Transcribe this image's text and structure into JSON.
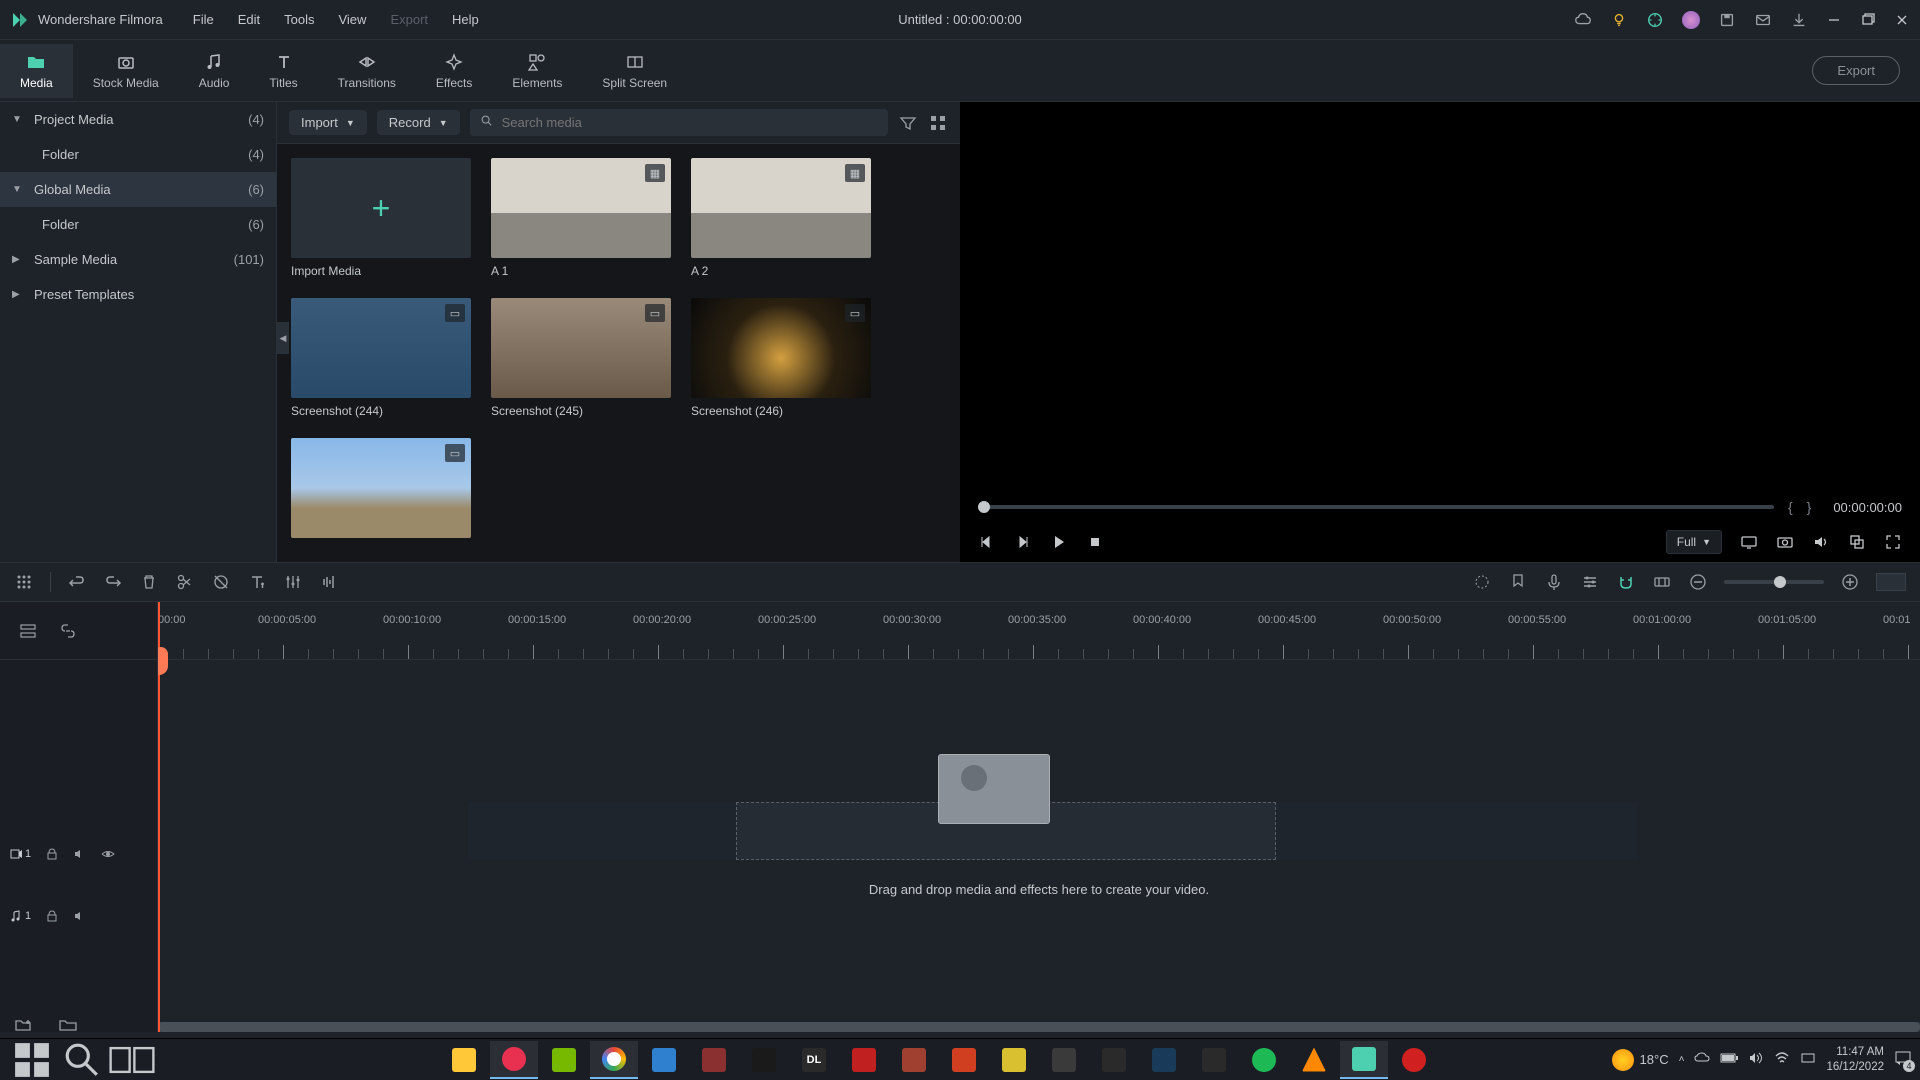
{
  "app": {
    "name": "Wondershare Filmora"
  },
  "titlebar": {
    "menus": [
      "File",
      "Edit",
      "Tools",
      "View",
      "Export",
      "Help"
    ],
    "disabled_menu_idx": 4,
    "title": "Untitled : 00:00:00:00"
  },
  "tabs": {
    "items": [
      "Media",
      "Stock Media",
      "Audio",
      "Titles",
      "Transitions",
      "Effects",
      "Elements",
      "Split Screen"
    ],
    "active": 0,
    "export": "Export"
  },
  "tree": {
    "items": [
      {
        "label": "Project Media",
        "count": "(4)",
        "arrow": "▼",
        "child": false
      },
      {
        "label": "Folder",
        "count": "(4)",
        "arrow": "",
        "child": true
      },
      {
        "label": "Global Media",
        "count": "(6)",
        "arrow": "▼",
        "child": false,
        "selected": true
      },
      {
        "label": "Folder",
        "count": "(6)",
        "arrow": "",
        "child": true
      },
      {
        "label": "Sample Media",
        "count": "(101)",
        "arrow": "▶",
        "child": false
      },
      {
        "label": "Preset Templates",
        "count": "",
        "arrow": "▶",
        "child": false
      }
    ]
  },
  "media_toolbar": {
    "import": "Import",
    "record": "Record",
    "search_placeholder": "Search media"
  },
  "media": {
    "items": [
      {
        "label": "Import Media",
        "type": "import"
      },
      {
        "label": "A 1",
        "type": "couch",
        "badge": "clip"
      },
      {
        "label": "A 2",
        "type": "couch",
        "badge": "clip"
      },
      {
        "label": "Screenshot (244)",
        "type": "eiffel-blue",
        "badge": "img"
      },
      {
        "label": "Screenshot (245)",
        "type": "street",
        "badge": "img"
      },
      {
        "label": "Screenshot (246)",
        "type": "eiffel-night",
        "badge": "img"
      },
      {
        "label": "",
        "type": "eiffel-day",
        "badge": "img"
      }
    ],
    "import_plus": "+"
  },
  "preview": {
    "timecode": "00:00:00:00",
    "quality": "Full"
  },
  "ruler": {
    "marks": [
      "00:00",
      "00:00:05:00",
      "00:00:10:00",
      "00:00:15:00",
      "00:00:20:00",
      "00:00:25:00",
      "00:00:30:00",
      "00:00:35:00",
      "00:00:40:00",
      "00:00:45:00",
      "00:00:50:00",
      "00:00:55:00",
      "00:01:00:00",
      "00:01:05:00",
      "00:01"
    ]
  },
  "tracks": {
    "video": "1",
    "audio": "1"
  },
  "timeline": {
    "drop_text": "Drag and drop media and effects here to create your video."
  },
  "taskbar": {
    "temp": "18°C",
    "time": "11:47 AM",
    "date": "16/12/2022",
    "notif": "4"
  }
}
